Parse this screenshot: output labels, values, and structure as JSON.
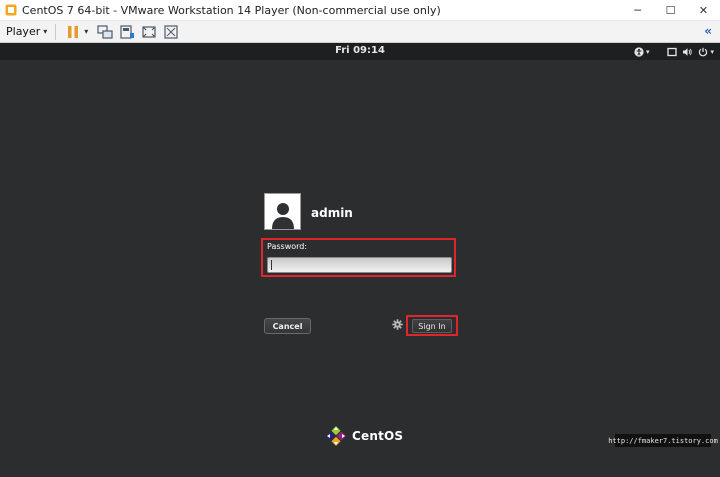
{
  "window": {
    "title": "CentOS 7 64-bit - VMware Workstation 14 Player (Non-commercial use only)",
    "minimize": "─",
    "maximize": "☐",
    "close": "✕"
  },
  "toolbar": {
    "player_label": "Player",
    "player_caret": "▾",
    "pause_caret": "▾",
    "collapse": "«",
    "icons": [
      "pause-icon",
      "send-ctrl-alt-del-icon",
      "removable-devices-icon",
      "fullscreen-icon",
      "unity-icon"
    ]
  },
  "gnome_bar": {
    "clock": "Fri 09:14",
    "accessibility_caret": "▾",
    "power_caret": "▾"
  },
  "login": {
    "username": "admin",
    "password_label": "Password:",
    "password_value": "",
    "cancel_label": "Cancel",
    "signin_label": "Sign In"
  },
  "branding": {
    "logo_text": "CentOS"
  },
  "watermark": "http://fmaker7.tistory.com",
  "colors": {
    "highlight": "#e0262b",
    "background": "#2b2d2e",
    "top_bar": "#1d1f20"
  }
}
